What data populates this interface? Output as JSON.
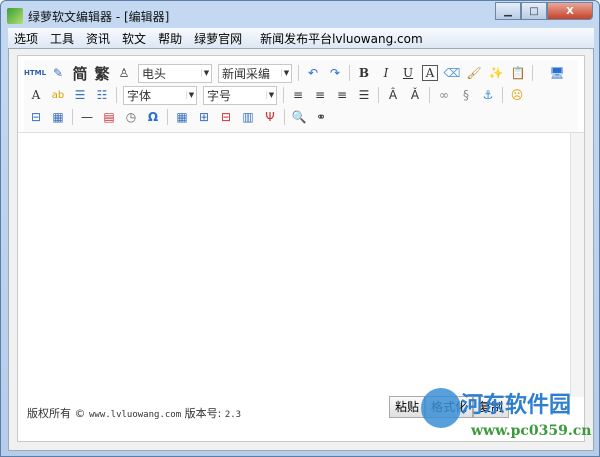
{
  "window": {
    "title": "绿萝软文编辑器 - [编辑器]",
    "minimize": "▁",
    "maximize": "□",
    "close": "X"
  },
  "menu": [
    "选项",
    "工具",
    "资讯",
    "软文",
    "帮助",
    "绿萝官网",
    "新闻发布平台lvluowang.com"
  ],
  "toolbar": {
    "html_label": "HTML",
    "simplified": "简",
    "traditional": "繁",
    "style_select": "电头",
    "category_select": "新闻采编",
    "font_select": "字体",
    "size_select": "字号",
    "bold": "B",
    "italic": "I",
    "underline": "U",
    "boxed": "A",
    "font_color": "A",
    "omega": "Ω"
  },
  "footer": {
    "copyright": "版权所有 ©",
    "site": "www.lvluowang.com",
    "version_label": "版本号:",
    "version": "2.3"
  },
  "buttons": {
    "paste": "粘贴",
    "format": "格式化",
    "copy": "复制"
  },
  "watermark": {
    "name": "河东软件园",
    "url": "www.pc0359.cn"
  }
}
